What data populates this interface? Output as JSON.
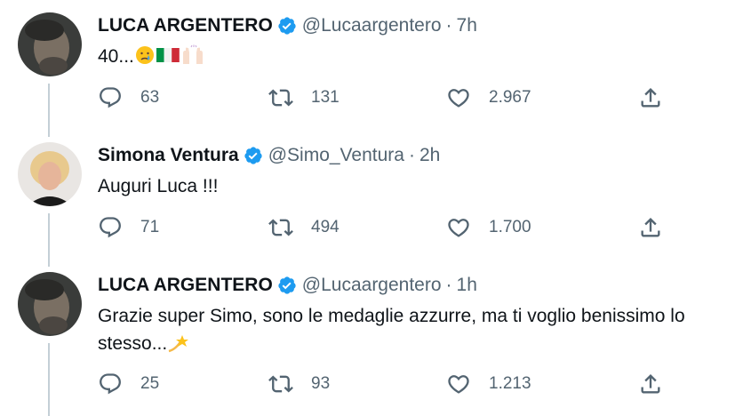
{
  "tweets": [
    {
      "name": "LUCA ARGENTERO",
      "handle": "@Lucaargentero",
      "time": "7h",
      "text": "40...",
      "emojis": [
        "crying-face-emoji",
        "italy-flag-emoji",
        "raised-hands-emoji"
      ],
      "replies": "63",
      "retweets": "131",
      "likes": "2.967"
    },
    {
      "name": "Simona Ventura",
      "handle": "@Simo_Ventura",
      "time": "2h",
      "text": "Auguri Luca !!!",
      "replies": "71",
      "retweets": "494",
      "likes": "1.700"
    },
    {
      "name": "LUCA ARGENTERO",
      "handle": "@Lucaargentero",
      "time": "1h",
      "text_line1": "Grazie super Simo, sono le medaglie azzurre, ma ti voglio benissimo lo",
      "text_line2": "stesso...",
      "emojis": [
        "dizzy-star-emoji"
      ],
      "replies": "25",
      "retweets": "93",
      "likes": "1.213"
    }
  ],
  "separator": "·",
  "colors": {
    "verified": "#1d9bf0",
    "muted": "#536471",
    "text": "#0f1419",
    "thread_line": "#c4cfd6"
  }
}
